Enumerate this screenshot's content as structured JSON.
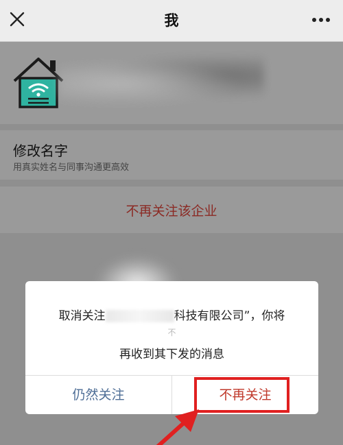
{
  "nav": {
    "title": "我",
    "close_icon": "close-icon",
    "more_icon": "more-dots-icon"
  },
  "profile": {
    "avatar_icon": "house-wifi-icon",
    "name": ""
  },
  "rename": {
    "title": "修改名字",
    "subtitle": "用真实姓名与同事沟通更高效"
  },
  "unfollow": {
    "label": "不再关注该企业"
  },
  "dialog": {
    "line1_prefix": "取消关注",
    "line1_suffix": "科技有限公司”，你将",
    "line1_small": "不",
    "line2": "再收到其下发的消息",
    "keep_label": "仍然关注",
    "stop_label": "不再关注"
  },
  "colors": {
    "accent_blue": "#4e6e96",
    "danger_red": "#c0392b",
    "highlight_red": "#e02020",
    "avatar_teal": "#2fb3a0"
  }
}
